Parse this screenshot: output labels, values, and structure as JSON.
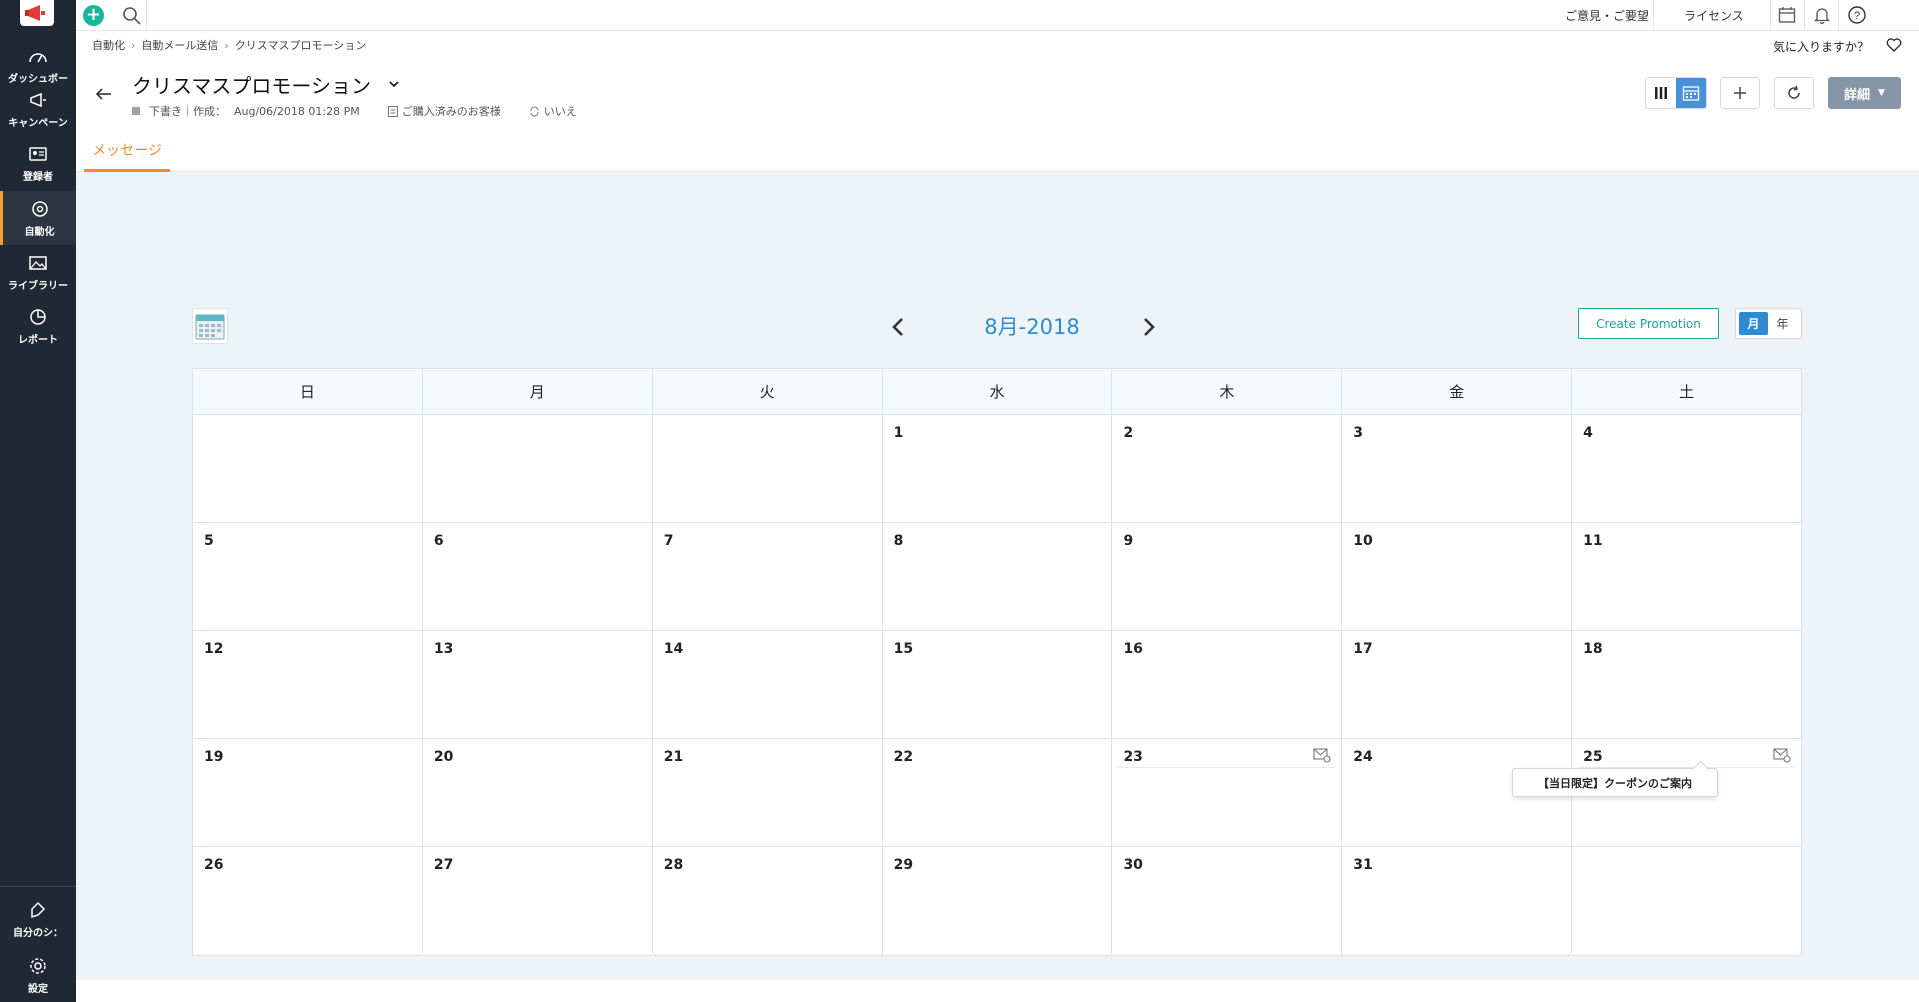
{
  "sidebar": {
    "items": [
      {
        "label": "ダッシュボー",
        "icon": "dashboard-icon"
      },
      {
        "label": "キャンペーン",
        "icon": "megaphone-icon"
      },
      {
        "label": "登録者",
        "icon": "contacts-icon"
      },
      {
        "label": "自動化",
        "icon": "automation-icon"
      },
      {
        "label": "ライブラリー",
        "icon": "library-icon"
      },
      {
        "label": "レポート",
        "icon": "report-icon"
      }
    ],
    "bottom": [
      {
        "label": "自分のシ：",
        "icon": "my-sign-icon"
      },
      {
        "label": "設定",
        "icon": "gear-icon"
      }
    ],
    "active_color": "#f0a032"
  },
  "topbar": {
    "feedback": "ご意見・ご要望",
    "license": "ライセンス"
  },
  "breadcrumb": [
    "自動化",
    "自動メール送信",
    "クリスマスプロモーション"
  ],
  "favorite_prompt": "気に入りますか？",
  "header": {
    "title": "クリスマスプロモーション",
    "status": "下書き｜作成：",
    "created": "Aug/06/2018 01:28 PM",
    "segment": "ご購入済みのお客様",
    "repeat": "いいえ",
    "detail_button": "詳細"
  },
  "tabs": [
    {
      "label": "メッセージ",
      "active": true
    }
  ],
  "calendar": {
    "month_title": "8月-2018",
    "create_button": "Create Promotion",
    "view_month": "月",
    "view_year": "年",
    "weekdays": [
      "日",
      "月",
      "火",
      "水",
      "木",
      "金",
      "土"
    ],
    "weeks": [
      [
        "",
        "",
        "",
        "1",
        "2",
        "3",
        "4"
      ],
      [
        "5",
        "6",
        "7",
        "8",
        "9",
        "10",
        "11"
      ],
      [
        "12",
        "13",
        "14",
        "15",
        "16",
        "17",
        "18"
      ],
      [
        "19",
        "20",
        "21",
        "22",
        "23",
        "24",
        "25"
      ],
      [
        "26",
        "27",
        "28",
        "29",
        "30",
        "31",
        ""
      ]
    ],
    "tooltip": "【当日限定】クーポンのご案内",
    "accent": "#2c8bd3"
  }
}
